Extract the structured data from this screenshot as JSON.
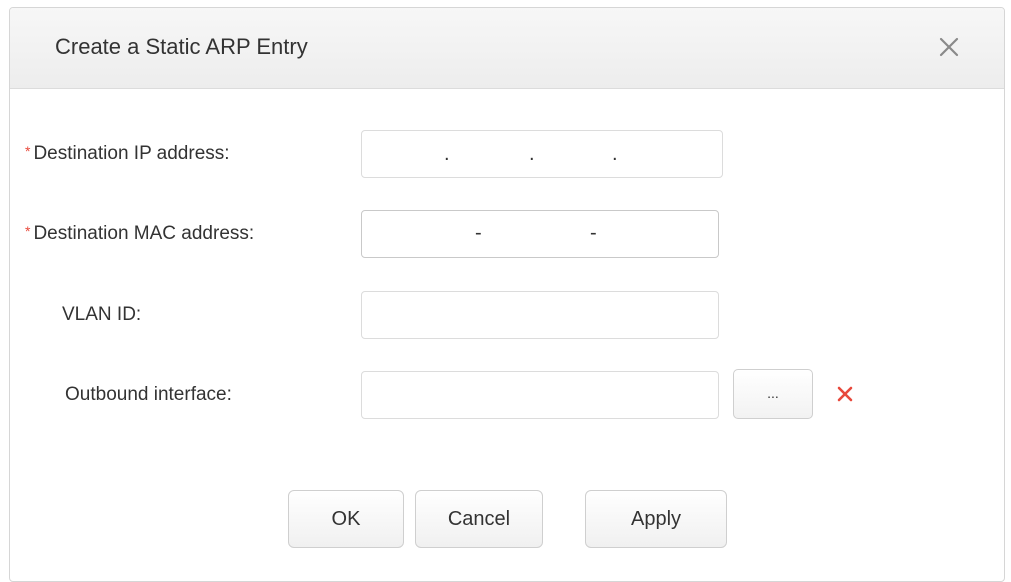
{
  "dialog": {
    "title": "Create a Static ARP Entry",
    "close_icon": "close-icon"
  },
  "form": {
    "ip": {
      "label": "Destination IP address:",
      "required_mark": "*",
      "segments": [
        "",
        "",
        "",
        ""
      ],
      "separator": "."
    },
    "mac": {
      "label": "Destination MAC address:",
      "required_mark": "*",
      "segments": [
        "",
        "",
        ""
      ],
      "separator": "-"
    },
    "vlan": {
      "label": "VLAN ID:",
      "value": ""
    },
    "outbound": {
      "label": "Outbound interface:",
      "value": "",
      "browse_label": "...",
      "clear_icon": "clear-x-icon"
    }
  },
  "buttons": {
    "ok": "OK",
    "cancel": "Cancel",
    "apply": "Apply"
  },
  "colors": {
    "required": "#e8483b",
    "clear_icon": "#e8483b"
  }
}
